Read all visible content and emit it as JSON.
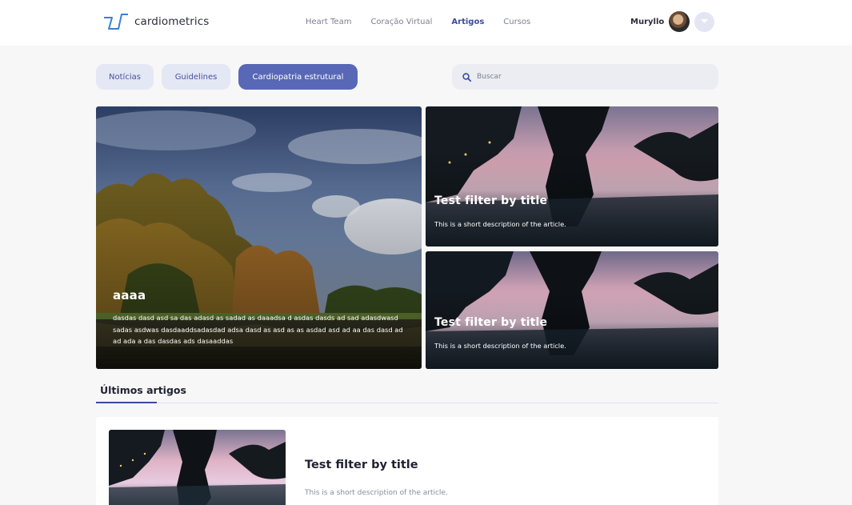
{
  "header": {
    "brand": "cardiometrics",
    "nav": [
      {
        "label": "Heart Team",
        "active": false
      },
      {
        "label": "Coração Virtual",
        "active": false
      },
      {
        "label": "Artigos",
        "active": true
      },
      {
        "label": "Cursos",
        "active": false
      }
    ],
    "user_name": "Muryllo"
  },
  "filters": {
    "chips": [
      {
        "label": "Notícias",
        "active": false
      },
      {
        "label": "Guidelines",
        "active": false
      },
      {
        "label": "Cardiopatria estrutural",
        "active": true
      }
    ],
    "search_placeholder": "Buscar"
  },
  "featured": {
    "main": {
      "title": "aaaa",
      "description": "dasdas dasd asd sa das adasd as sadad as daaadsa d asdas dasds ad sad adasdwasd sadas asdwas dasdaaddsadasdad adsa dasd as asd as as asdad asd ad aa das dasd ad ad ada a das dasdas ads dasaaddas"
    },
    "side": [
      {
        "title": "Test filter by title",
        "description": "This is a short description of the article."
      },
      {
        "title": "Test filter by title",
        "description": "This is a short description of the article."
      }
    ]
  },
  "latest": {
    "section_title": "Últimos artigos",
    "items": [
      {
        "title": "Test filter by title",
        "description": "This is a short description of the article."
      }
    ]
  },
  "colors": {
    "accent": "#3c4aa0",
    "chip_active_bg": "#5868b6",
    "chip_bg": "#e4e7f4",
    "page_bg": "#f7f7f8"
  },
  "icons": {
    "logo": "heart-wave-logo-icon",
    "search": "search-icon",
    "user_menu": "chevron-down-icon"
  }
}
